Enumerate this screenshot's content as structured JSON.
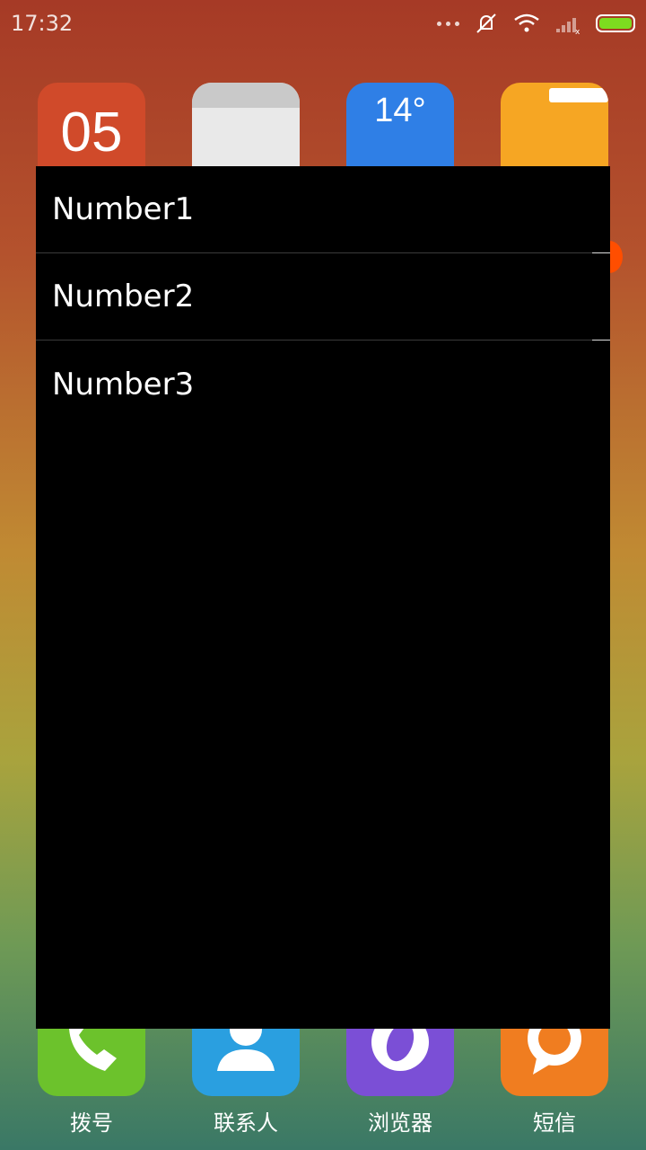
{
  "status_bar": {
    "time": "17:32",
    "icons": [
      "more-dots-icon",
      "mute-icon",
      "wifi-icon",
      "signal-icon",
      "battery-icon"
    ],
    "battery_color": "#7ddc1f"
  },
  "home_icons": {
    "calendar_day": "05",
    "weather_temp": "14°"
  },
  "popup": {
    "items": [
      "Number1",
      "Number2",
      "Number3"
    ]
  },
  "dock": {
    "labels": [
      "拨号",
      "联系人",
      "浏览器",
      "短信"
    ]
  }
}
